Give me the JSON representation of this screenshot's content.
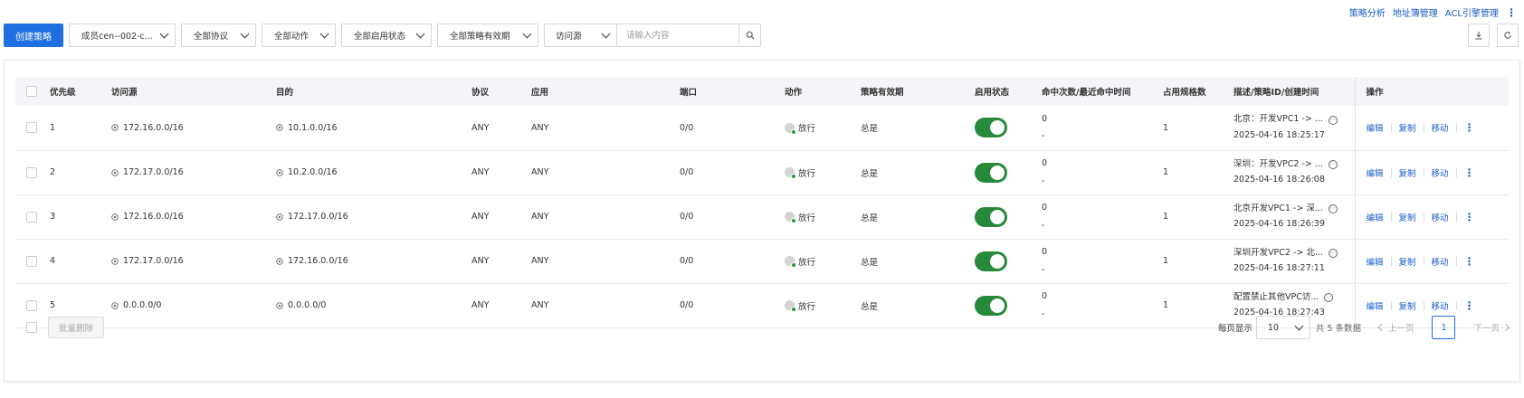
{
  "top_links": {
    "policy_analysis": "策略分析",
    "address_book": "地址簿管理",
    "acl_engine": "ACL引擎管理"
  },
  "toolbar": {
    "create_button": "创建策略",
    "filters": {
      "member": "成员cen--002-c...",
      "protocol": "全部协议",
      "action": "全部动作",
      "enable_state": "全部启用状态",
      "validity": "全部策略有效期"
    },
    "search": {
      "source_type": "访问源",
      "placeholder": "请输入内容"
    }
  },
  "table": {
    "headers": {
      "priority": "优先级",
      "source": "访问源",
      "destination": "目的",
      "protocol": "协议",
      "application": "应用",
      "port": "端口",
      "action": "动作",
      "validity": "策略有效期",
      "status": "启用状态",
      "hits": "命中次数/最近命中时间",
      "spec_usage": "占用规格数",
      "description": "描述/策略ID/创建时间",
      "operations": "操作"
    },
    "rows": [
      {
        "priority": "1",
        "source": "172.16.0.0/16",
        "destination": "10.1.0.0/16",
        "protocol": "ANY",
        "application": "ANY",
        "port": "0/0",
        "action": "放行",
        "validity": "总是",
        "enabled": true,
        "hit_count": "0",
        "last_hit": "-",
        "spec_usage": "1",
        "description": "北京：开发VPC1 -> ...",
        "created": "2025-04-16 18:25:17"
      },
      {
        "priority": "2",
        "source": "172.17.0.0/16",
        "destination": "10.2.0.0/16",
        "protocol": "ANY",
        "application": "ANY",
        "port": "0/0",
        "action": "放行",
        "validity": "总是",
        "enabled": true,
        "hit_count": "0",
        "last_hit": "-",
        "spec_usage": "1",
        "description": "深圳：开发VPC2 -> ...",
        "created": "2025-04-16 18:26:08"
      },
      {
        "priority": "3",
        "source": "172.16.0.0/16",
        "destination": "172.17.0.0/16",
        "protocol": "ANY",
        "application": "ANY",
        "port": "0/0",
        "action": "放行",
        "validity": "总是",
        "enabled": true,
        "hit_count": "0",
        "last_hit": "-",
        "spec_usage": "1",
        "description": "北京开发VPC1 -> 深...",
        "created": "2025-04-16 18:26:39"
      },
      {
        "priority": "4",
        "source": "172.17.0.0/16",
        "destination": "172.16.0.0/16",
        "protocol": "ANY",
        "application": "ANY",
        "port": "0/0",
        "action": "放行",
        "validity": "总是",
        "enabled": true,
        "hit_count": "0",
        "last_hit": "-",
        "spec_usage": "1",
        "description": "深圳开发VPC2 -> 北...",
        "created": "2025-04-16 18:27:11"
      },
      {
        "priority": "5",
        "source": "0.0.0.0/0",
        "destination": "0.0.0.0/0",
        "protocol": "ANY",
        "application": "ANY",
        "port": "0/0",
        "action": "放行",
        "validity": "总是",
        "enabled": true,
        "hit_count": "0",
        "last_hit": "-",
        "spec_usage": "1",
        "description": "配置禁止其他VPC访...",
        "created": "2025-04-16 18:27:43"
      }
    ],
    "row_ops": {
      "edit": "编辑",
      "copy": "复制",
      "move": "移动"
    }
  },
  "footer": {
    "batch_delete": "批量删除",
    "page_size_label": "每页显示",
    "page_size": "10",
    "total": "共 5 条数据",
    "prev": "上一页",
    "current_page": "1",
    "next": "下一页"
  },
  "colors": {
    "primary": "#1f6fe0",
    "link": "#1a5dc8",
    "toggle_on": "#268a3a",
    "allow_dot": "#2b9a3c"
  }
}
